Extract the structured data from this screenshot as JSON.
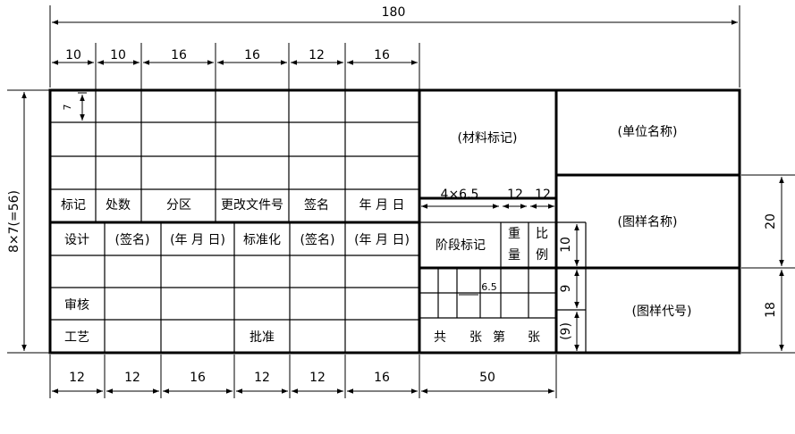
{
  "dimensions": {
    "total_width": "180",
    "top_columns": [
      "10",
      "10",
      "16",
      "16",
      "12",
      "16"
    ],
    "bottom_columns": [
      "12",
      "12",
      "16",
      "12",
      "12",
      "16",
      "50"
    ],
    "left_height": "8×7(=56)",
    "row_height": "7",
    "right_heights": [
      "20",
      "18"
    ],
    "mid_widths": [
      "4×6.5",
      "12",
      "12"
    ],
    "vertical_labels": [
      "10",
      "9",
      "(9)"
    ],
    "step_width": "6.5"
  },
  "revision_block": {
    "headers": [
      "标记",
      "处数",
      "分区",
      "更改文件号",
      "签名",
      "年 月 日"
    ]
  },
  "signature_block": {
    "row1": [
      "设计",
      "(签名)",
      "(年 月 日)",
      "标准化",
      "(签名)",
      "(年 月 日)"
    ],
    "review": "审核",
    "process": "工艺",
    "approve": "批准"
  },
  "material_block": {
    "material_mark": "(材料标记)",
    "stage_mark": "阶段标记",
    "weight": [
      "重",
      "量"
    ],
    "scale": [
      "比",
      "例"
    ],
    "sheets": [
      "共",
      "张",
      "第",
      "张"
    ]
  },
  "right_block": {
    "unit_name": "(单位名称)",
    "drawing_name": "(图样名称)",
    "drawing_code": "(图样代号)"
  }
}
